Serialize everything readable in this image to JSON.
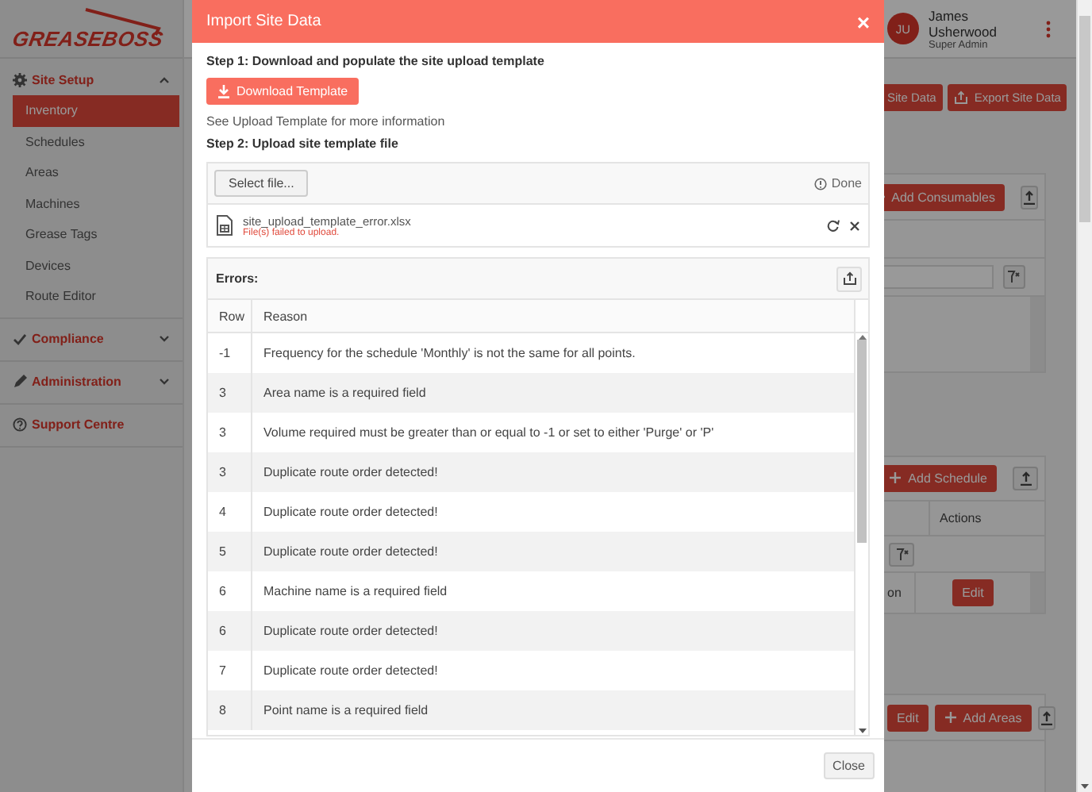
{
  "app": {
    "logo": "GREASEBOSS",
    "user": {
      "initials": "JU",
      "name": "James Usherwood",
      "role": "Super Admin"
    }
  },
  "sidebar": {
    "sections": [
      {
        "kind": "group",
        "label": "Site Setup",
        "expanded": true,
        "children": [
          {
            "label": "Inventory",
            "selected": true
          },
          {
            "label": "Schedules",
            "selected": false
          },
          {
            "label": "Areas",
            "selected": false
          },
          {
            "label": "Machines",
            "selected": false
          },
          {
            "label": "Grease Tags",
            "selected": false
          },
          {
            "label": "Devices",
            "selected": false
          },
          {
            "label": "Route Editor",
            "selected": false
          }
        ]
      },
      {
        "kind": "group",
        "label": "Compliance",
        "expanded": false
      },
      {
        "kind": "group",
        "label": "Administration",
        "expanded": false
      },
      {
        "kind": "link",
        "label": "Support Centre"
      }
    ]
  },
  "page": {
    "actions": [
      "Site Data",
      "Export Site Data"
    ],
    "panels": [
      {
        "add_button": "Add Consumables"
      },
      {
        "add_button": "Add Schedule",
        "column": "Actions",
        "cell": "on",
        "row_button": "Edit"
      },
      {
        "edit_button": "Edit",
        "add_button": "Add Areas"
      }
    ]
  },
  "modal": {
    "title": "Import Site Data",
    "close": "×",
    "step1": "Step 1: Download and populate the site upload template",
    "download_button": "Download Template",
    "note": "See Upload Template for more information",
    "step2": "Step 2: Upload site template file",
    "upload": {
      "select_button": "Select file...",
      "status": "Done",
      "file": {
        "name": "site_upload_template_error.xlsx",
        "error": "File(s) failed to upload."
      }
    },
    "errors": {
      "title": "Errors:",
      "columns": [
        "Row",
        "Reason"
      ],
      "rows": [
        [
          "-1",
          "Frequency for the schedule 'Monthly' is not the same for all points."
        ],
        [
          "3",
          "Area name is a required field"
        ],
        [
          "3",
          "Volume required must be greater than or equal to -1 or set to either 'Purge' or 'P'"
        ],
        [
          "3",
          "Duplicate route order detected!"
        ],
        [
          "4",
          "Duplicate route order detected!"
        ],
        [
          "5",
          "Duplicate route order detected!"
        ],
        [
          "6",
          "Machine name is a required field"
        ],
        [
          "6",
          "Duplicate route order detected!"
        ],
        [
          "7",
          "Duplicate route order detected!"
        ],
        [
          "8",
          "Point name is a required field"
        ]
      ]
    },
    "footer_button": "Close"
  }
}
